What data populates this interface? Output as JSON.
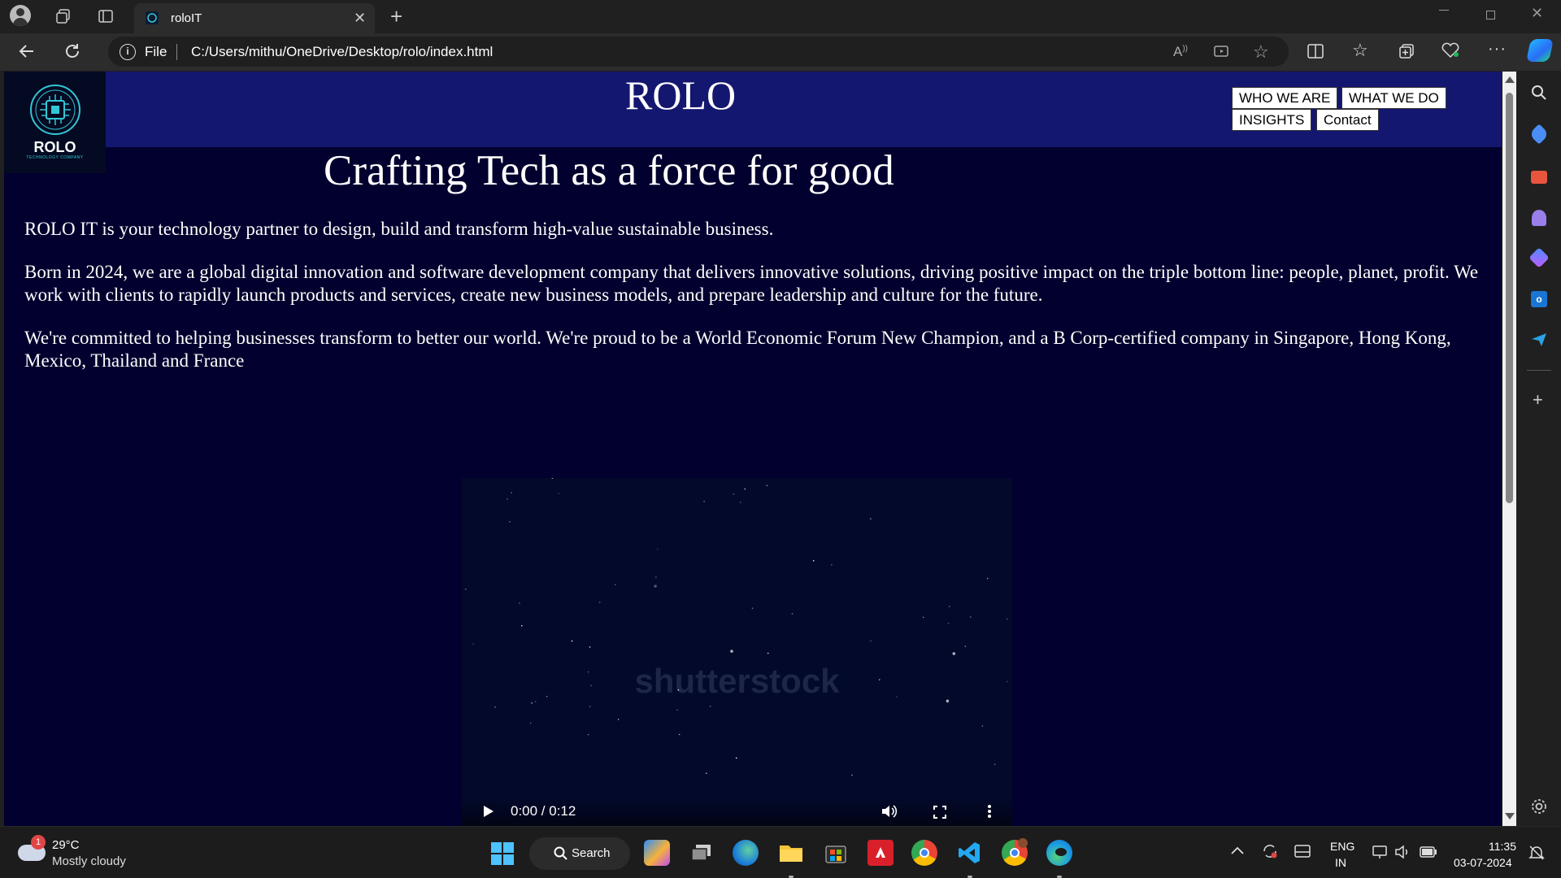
{
  "browser": {
    "tab_title": "roloIT",
    "site_info_label": "File",
    "url": "C:/Users/mithu/OneDrive/Desktop/rolo/index.html"
  },
  "page": {
    "logo_text": "ROLO",
    "logo_subtext": "TECHNOLOGY COMPANY",
    "site_title": "ROLO",
    "nav": {
      "who_we_are": "WHO WE ARE",
      "what_we_do": "WHAT WE DO",
      "insights": "INSIGHTS",
      "contact": "Contact"
    },
    "hero_title": "Crafting Tech as a force for good",
    "paragraphs": [
      "ROLO IT is your technology partner to design, build and transform high-value sustainable business.",
      "Born in 2024, we are a global digital innovation and software development company that delivers innovative solutions, driving positive impact on the triple bottom line: people, planet, profit. We work with clients to rapidly launch products and services, create new business models, and prepare leadership and culture for the future.",
      "We're committed to helping businesses transform to better our world. We're proud to be a World Economic Forum New Champion, and a B Corp-certified company in Singapore, Hong Kong, Mexico, Thailand and France"
    ],
    "video": {
      "watermark": "shutterstock",
      "time": "0:00 / 0:12"
    }
  },
  "taskbar": {
    "weather_badge": "1",
    "weather_temp": "29°C",
    "weather_desc": "Mostly cloudy",
    "search_label": "Search",
    "lang_line1": "ENG",
    "lang_line2": "IN",
    "time": "11:35",
    "date": "03-07-2024"
  },
  "colors": {
    "page_bg": "#02002e",
    "header_bg": "#14176f",
    "accent_teal": "#33c6d6"
  }
}
